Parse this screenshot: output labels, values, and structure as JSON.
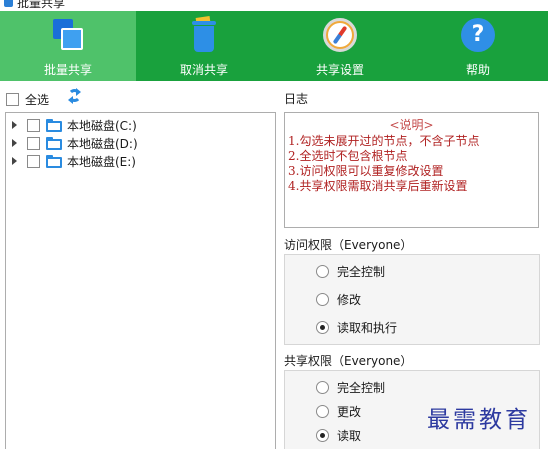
{
  "window": {
    "title": "批量共享"
  },
  "toolbar": {
    "items": [
      {
        "label": "批量共享",
        "icon": "batch-share-icon",
        "active": true
      },
      {
        "label": "取消共享",
        "icon": "trash-icon",
        "active": false
      },
      {
        "label": "共享设置",
        "icon": "compass-icon",
        "active": false
      },
      {
        "label": "帮助",
        "icon": "help-icon",
        "active": false
      }
    ],
    "colors": {
      "background": "#19a13d",
      "active": "#4fc26a"
    }
  },
  "left": {
    "select_all_label": "全选",
    "tree": [
      {
        "label": "本地磁盘(C:)"
      },
      {
        "label": "本地磁盘(D:)"
      },
      {
        "label": "本地磁盘(E:)"
      }
    ]
  },
  "right": {
    "log_title": "日志",
    "log": {
      "heading": "<说明>",
      "lines": [
        "1.勾选未展开过的节点，不含子节点",
        "2.全选时不包含根节点",
        "3.访问权限可以重复修改设置",
        "4.共享权限需取消共享后重新设置"
      ]
    },
    "access": {
      "title": "访问权限（Everyone）",
      "options": [
        "完全控制",
        "修改",
        "读取和执行"
      ],
      "selected": "读取和执行"
    },
    "share": {
      "title": "共享权限（Everyone）",
      "options": [
        "完全控制",
        "更改",
        "读取"
      ],
      "selected": "读取"
    }
  },
  "watermark": "最需教育"
}
